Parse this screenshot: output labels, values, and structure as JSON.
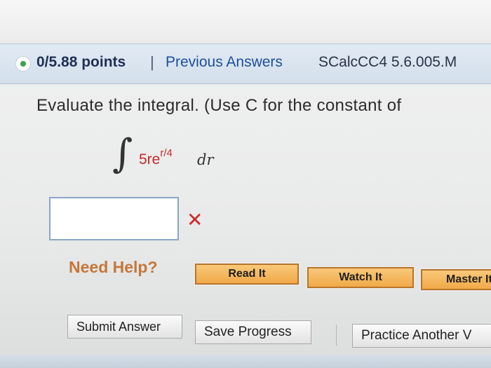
{
  "header": {
    "points": "0/5.88 points",
    "separator": "|",
    "previous_answers": "Previous Answers",
    "problem_code": "SCalcCC4 5.6.005.M",
    "status_icon": "green-dot-icon"
  },
  "question": {
    "prompt": "Evaluate the integral. (Use C for the constant of",
    "integral_symbol": "∫",
    "integrand_base": "5re",
    "integrand_exponent": "r/4",
    "differential": "dr"
  },
  "answer": {
    "value": "",
    "result_icon": "x-mark-icon",
    "result_symbol": "✕"
  },
  "help": {
    "label": "Need Help?",
    "read_it": "Read It",
    "watch_it": "Watch It",
    "master_it": "Master It"
  },
  "actions": {
    "submit": "Submit Answer",
    "save": "Save Progress",
    "practice": "Practice Another V"
  },
  "colors": {
    "header_bg": "#d3dfec",
    "points_text": "#1f2f55",
    "link_blue": "#1c4f9d",
    "incorrect_red": "#d02828",
    "help_orange": "#f0a948"
  }
}
